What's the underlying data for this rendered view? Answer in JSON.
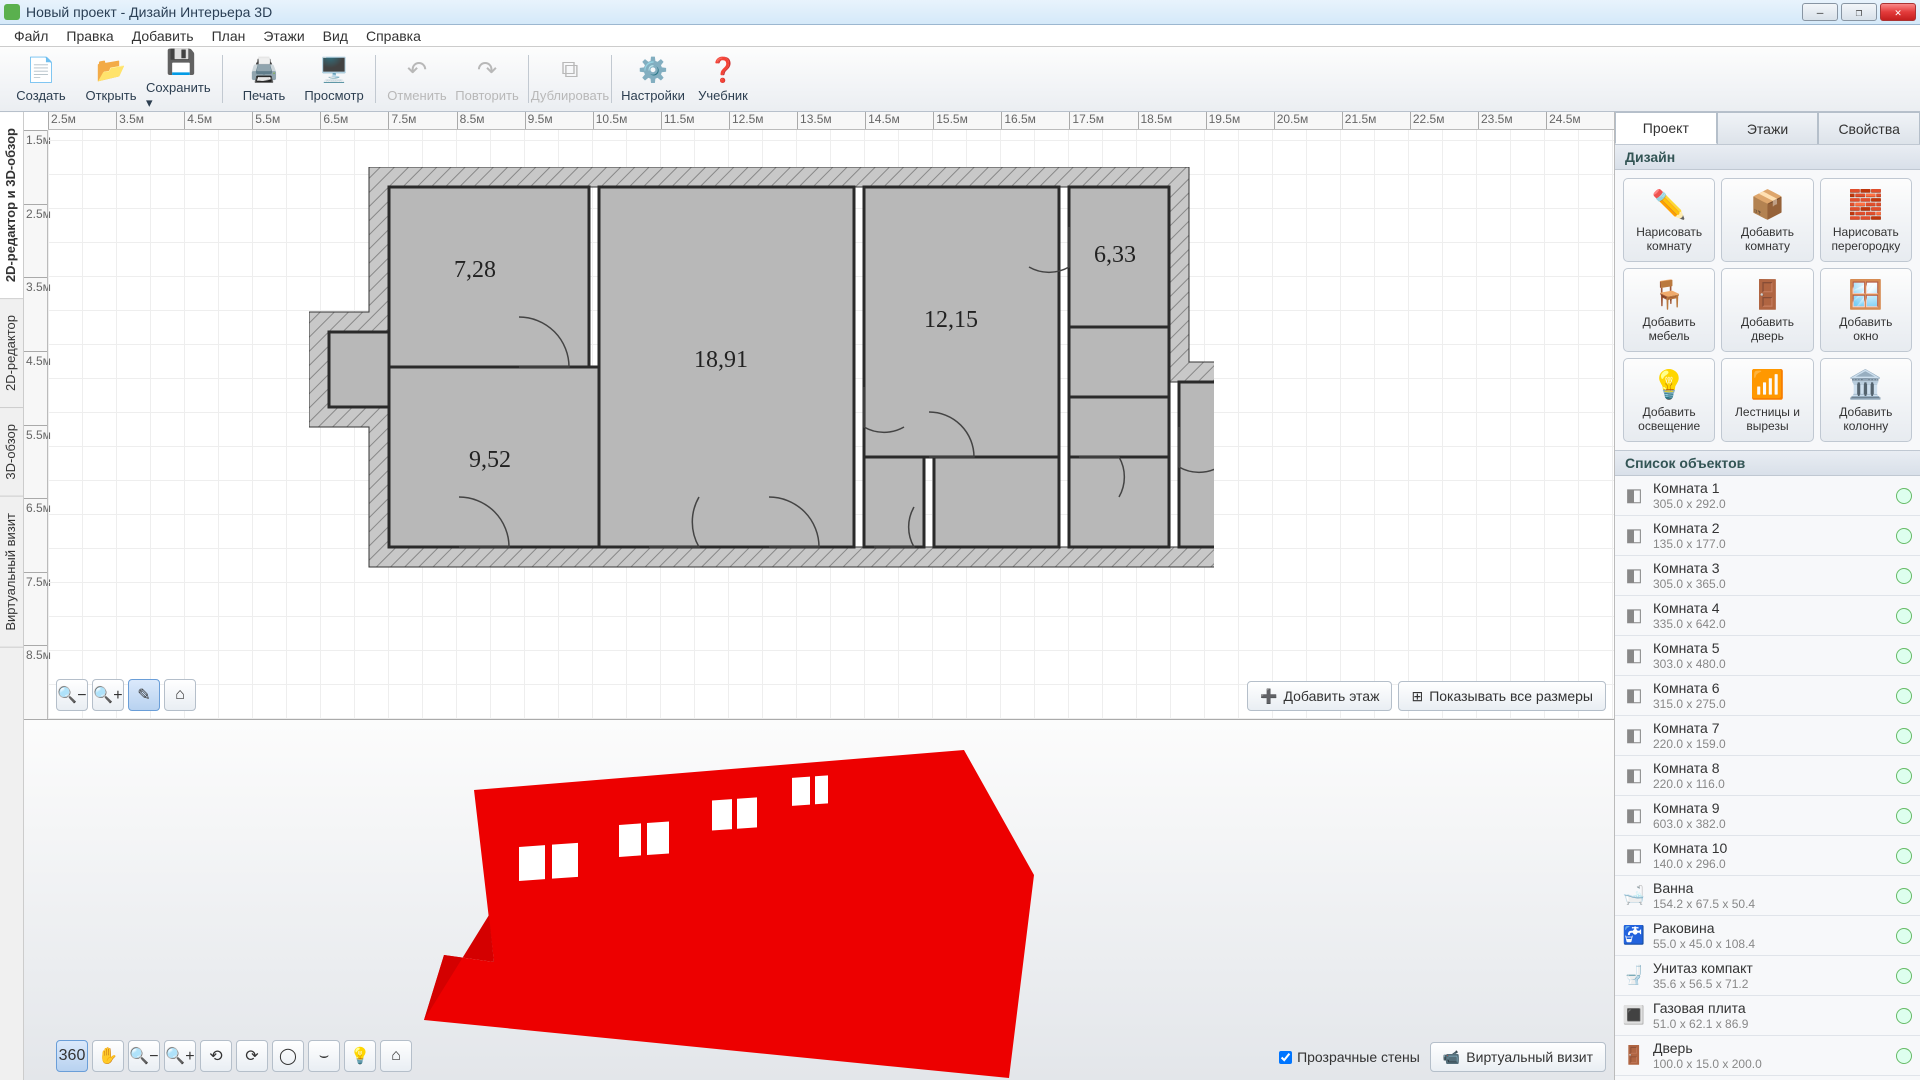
{
  "window": {
    "title": "Новый проект - Дизайн Интерьера 3D"
  },
  "menu": [
    "Файл",
    "Правка",
    "Добавить",
    "План",
    "Этажи",
    "Вид",
    "Справка"
  ],
  "toolbar": [
    {
      "id": "create",
      "label": "Создать",
      "icon": "📄",
      "group": 0
    },
    {
      "id": "open",
      "label": "Открыть",
      "icon": "📂",
      "group": 0
    },
    {
      "id": "save",
      "label": "Сохранить",
      "icon": "💾",
      "group": 0,
      "dropdown": true
    },
    {
      "id": "print",
      "label": "Печать",
      "icon": "🖨️",
      "group": 1
    },
    {
      "id": "preview",
      "label": "Просмотр",
      "icon": "🖥️",
      "group": 1
    },
    {
      "id": "undo",
      "label": "Отменить",
      "icon": "↶",
      "group": 2,
      "disabled": true
    },
    {
      "id": "redo",
      "label": "Повторить",
      "icon": "↷",
      "group": 2,
      "disabled": true
    },
    {
      "id": "dup",
      "label": "Дублировать",
      "icon": "⧉",
      "group": 3,
      "disabled": true
    },
    {
      "id": "settings",
      "label": "Настройки",
      "icon": "⚙️",
      "group": 4
    },
    {
      "id": "tutorial",
      "label": "Учебник",
      "icon": "❓",
      "group": 4
    }
  ],
  "vtabs": [
    "2D-редактор и 3D-обзор",
    "2D-редактор",
    "3D-обзор",
    "Виртуальный визит"
  ],
  "ruler_h": [
    "2.5м",
    "3.5м",
    "4.5м",
    "5.5м",
    "6.5м",
    "7.5м",
    "8.5м",
    "9.5м",
    "10.5м",
    "11.5м",
    "12.5м",
    "13.5м",
    "14.5м",
    "15.5м",
    "16.5м",
    "17.5м",
    "18.5м",
    "19.5м",
    "20.5м",
    "21.5м",
    "22.5м",
    "23.5м",
    "24.5м"
  ],
  "ruler_v": [
    "1.5м",
    "2.5м",
    "3.5м",
    "4.5м",
    "5.5м",
    "6.5м",
    "7.5м",
    "8.5м"
  ],
  "rooms": {
    "r1": "7,28",
    "r2": "18,91",
    "r3": "12,15",
    "r4": "6,33",
    "r5": "9,52"
  },
  "view2d_buttons": {
    "add_floor": "Добавить этаж",
    "show_dims": "Показывать все размеры"
  },
  "view3d": {
    "transparent": "Прозрачные стены",
    "virtual": "Виртуальный визит"
  },
  "rtabs": [
    "Проект",
    "Этажи",
    "Свойства"
  ],
  "rsections": {
    "design": "Дизайн",
    "objects": "Список объектов"
  },
  "tools": [
    {
      "id": "draw-room",
      "label": "Нарисовать\nкомнату",
      "icon": "✏️"
    },
    {
      "id": "add-room",
      "label": "Добавить\nкомнату",
      "icon": "📦"
    },
    {
      "id": "draw-partition",
      "label": "Нарисовать\nперегородку",
      "icon": "🧱"
    },
    {
      "id": "add-furniture",
      "label": "Добавить\nмебель",
      "icon": "🪑"
    },
    {
      "id": "add-door",
      "label": "Добавить\nдверь",
      "icon": "🚪"
    },
    {
      "id": "add-window",
      "label": "Добавить\nокно",
      "icon": "🪟"
    },
    {
      "id": "add-light",
      "label": "Добавить\nосвещение",
      "icon": "💡"
    },
    {
      "id": "stairs",
      "label": "Лестницы и\nвырезы",
      "icon": "📶"
    },
    {
      "id": "add-column",
      "label": "Добавить\nколонну",
      "icon": "🏛️"
    }
  ],
  "objects": [
    {
      "name": "Комната 1",
      "dim": "305.0 x 292.0",
      "icon": "◧"
    },
    {
      "name": "Комната 2",
      "dim": "135.0 x 177.0",
      "icon": "◧"
    },
    {
      "name": "Комната 3",
      "dim": "305.0 x 365.0",
      "icon": "◧"
    },
    {
      "name": "Комната 4",
      "dim": "335.0 x 642.0",
      "icon": "◧"
    },
    {
      "name": "Комната 5",
      "dim": "303.0 x 480.0",
      "icon": "◧"
    },
    {
      "name": "Комната 6",
      "dim": "315.0 x 275.0",
      "icon": "◧"
    },
    {
      "name": "Комната 7",
      "dim": "220.0 x 159.0",
      "icon": "◧"
    },
    {
      "name": "Комната 8",
      "dim": "220.0 x 116.0",
      "icon": "◧"
    },
    {
      "name": "Комната 9",
      "dim": "603.0 x 382.0",
      "icon": "◧"
    },
    {
      "name": "Комната 10",
      "dim": "140.0 x 296.0",
      "icon": "◧"
    },
    {
      "name": "Ванна",
      "dim": "154.2 x 67.5 x 50.4",
      "icon": "🛁"
    },
    {
      "name": "Раковина",
      "dim": "55.0 x 45.0 x 108.4",
      "icon": "🚰"
    },
    {
      "name": "Унитаз компакт",
      "dim": "35.6 x 56.5 x 71.2",
      "icon": "🚽"
    },
    {
      "name": "Газовая плита",
      "dim": "51.0 x 62.1 x 86.9",
      "icon": "🔳"
    },
    {
      "name": "Дверь",
      "dim": "100.0 x 15.0 x 200.0",
      "icon": "🚪"
    }
  ]
}
